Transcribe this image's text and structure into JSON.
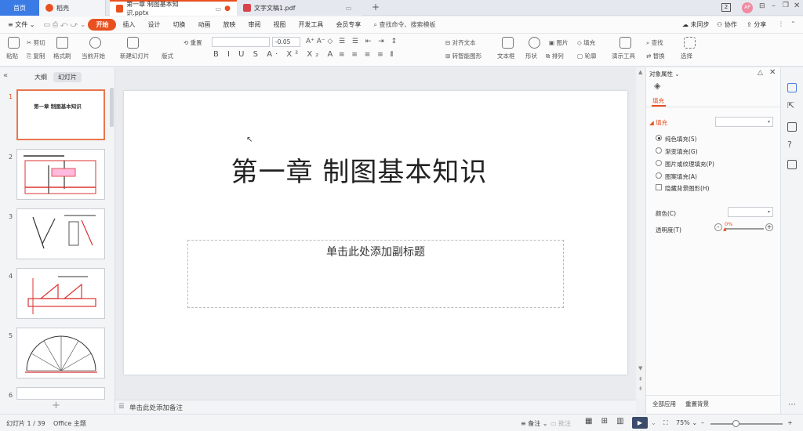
{
  "titlebar": {
    "home_tab": "首页",
    "tab1": "稻壳",
    "tab2": "第一章 制图基本知识.pptx",
    "tab3": "文字文稿1.pdf",
    "add_tab": "+",
    "badge": "2",
    "avatar": "AP"
  },
  "menu": {
    "file": "文件",
    "items": [
      "开始",
      "插入",
      "设计",
      "切换",
      "动画",
      "放映",
      "审阅",
      "视图",
      "开发工具",
      "会员专享"
    ],
    "search": "查找命令、搜索模板",
    "unsynced": "未同步",
    "collab": "协作",
    "share": "分享"
  },
  "ribbon": {
    "paste": "粘贴",
    "cut": "剪切",
    "copy": "复制",
    "format_painter": "格式刷",
    "play_from_current": "当前开始",
    "new_slide": "新建幻灯片",
    "layout": "版式",
    "reset": "重置",
    "font_size": "0.05",
    "align_text": "对齐文本",
    "smart_graphic": "转智能图形",
    "textbox": "文本框",
    "shape": "形状",
    "arrange": "排列",
    "picture": "图片",
    "fill": "填充",
    "outline": "轮廓",
    "demo_tools": "演示工具",
    "find": "查找",
    "replace": "替换",
    "select": "选择"
  },
  "leftpane": {
    "tab_outline": "大纲",
    "tab_slides": "幻灯片",
    "thumb1_title": "第一章 制图基本知识",
    "slide_numbers": [
      "1",
      "2",
      "3",
      "4",
      "5",
      "6"
    ]
  },
  "slide": {
    "title": "第一章 制图基本知识",
    "subtitle_placeholder": "单击此处添加副标题"
  },
  "notes": {
    "placeholder": "单击此处添加备注"
  },
  "rightpane": {
    "header": "对象属性",
    "tab_fill": "填充",
    "section_fill": "填充",
    "options": [
      {
        "label": "纯色填充(S)",
        "checked": true
      },
      {
        "label": "渐变填充(G)",
        "checked": false
      },
      {
        "label": "图片或纹理填充(P)",
        "checked": false
      },
      {
        "label": "图案填充(A)",
        "checked": false
      }
    ],
    "hide_bg": "隐藏背景图形(H)",
    "color_label": "颜色(C)",
    "transparency_label": "透明度(T)",
    "transparency_value": "0%",
    "apply_all": "全部应用",
    "reset_bg": "重置背景"
  },
  "status": {
    "slide_info": "幻灯片 1 / 39",
    "theme": "Office 主题",
    "notes": "备注",
    "comments": "批注",
    "zoom": "75%"
  },
  "colors": {
    "accent": "#e8501f",
    "home_tab": "#3b7be5"
  }
}
